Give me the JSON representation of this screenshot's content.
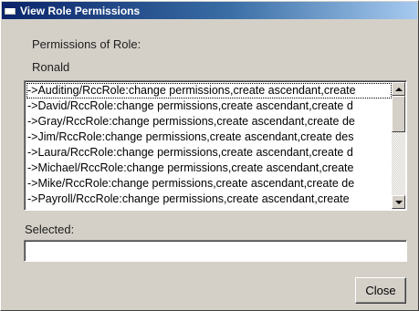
{
  "window": {
    "title": "View Role Permissions",
    "icon": "window-icon"
  },
  "header": {
    "permissions_label": "Permissions of Role:",
    "role_name": "Ronald"
  },
  "list": {
    "items": [
      "->Auditing/RccRole:change permissions,create ascendant,create",
      "->David/RccRole:change permissions,create ascendant,create d",
      "->Gray/RccRole:change permissions,create ascendant,create de",
      "->Jim/RccRole:change permissions,create ascendant,create des",
      "->Laura/RccRole:change permissions,create ascendant,create d",
      "->Michael/RccRole:change permissions,create ascendant,create",
      "->Mike/RccRole:change permissions,create ascendant,create de",
      "->Payroll/RccRole:change permissions,create ascendant,create"
    ]
  },
  "selected": {
    "label": "Selected:",
    "value": "",
    "placeholder": ""
  },
  "buttons": {
    "close_label": "Close"
  }
}
